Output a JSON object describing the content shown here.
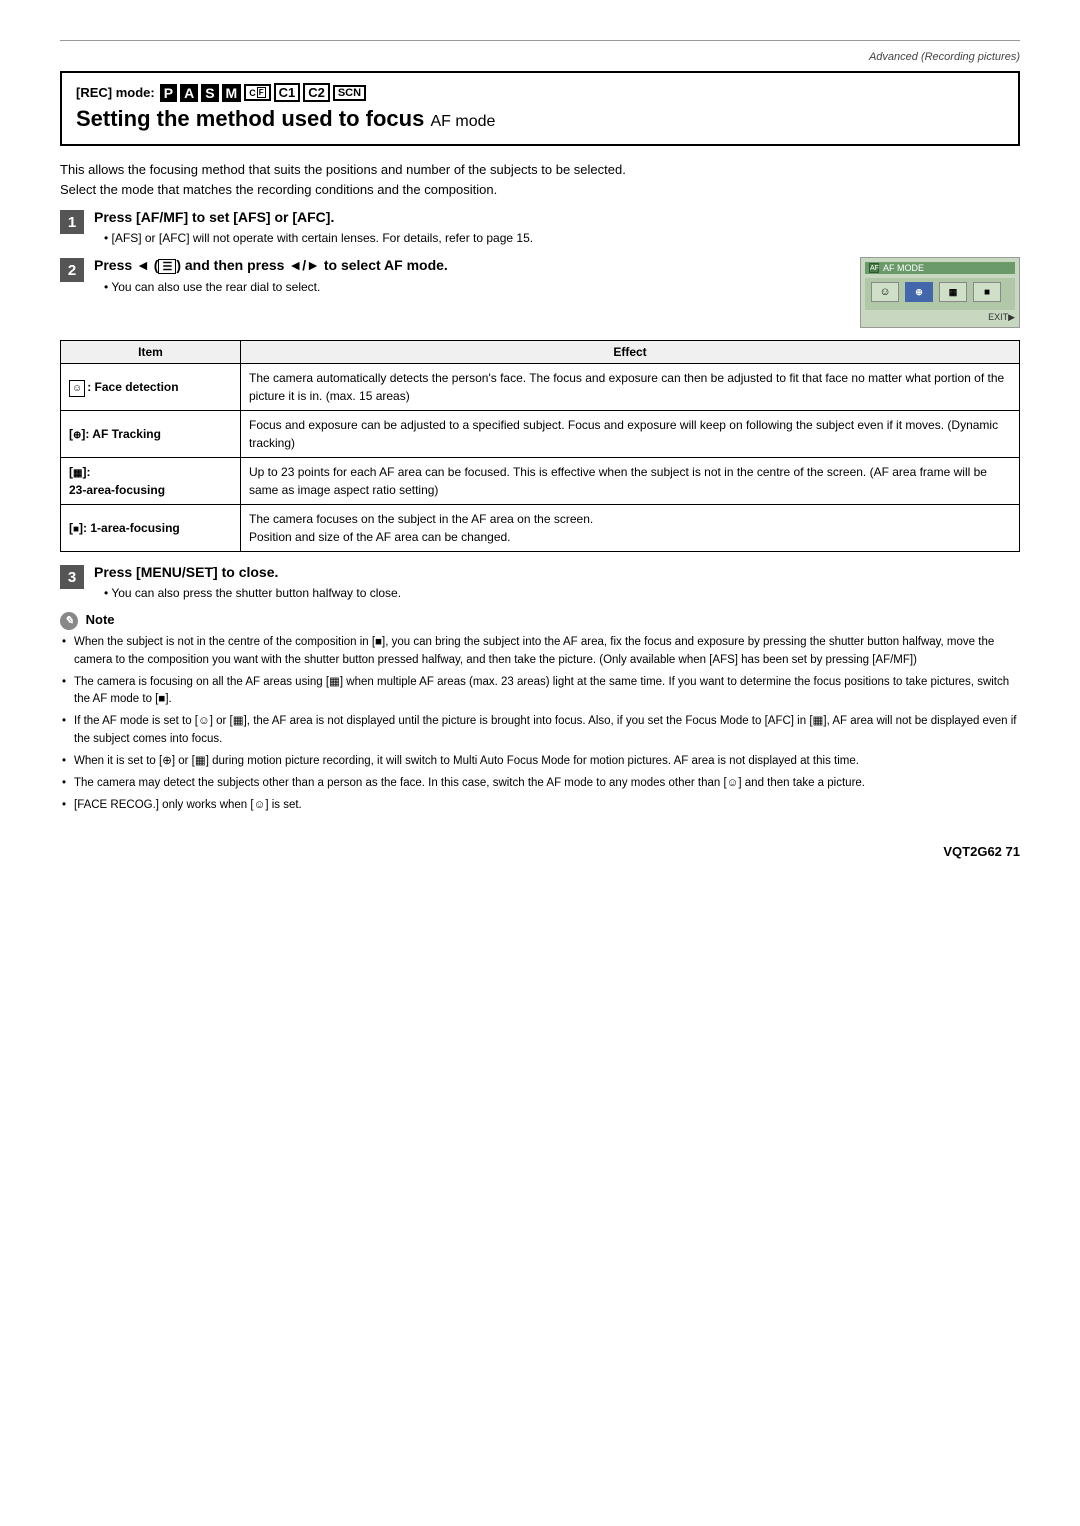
{
  "page": {
    "header": "Advanced (Recording pictures)",
    "footer": "VQT2G62  71"
  },
  "rec_mode": {
    "label": "[REC] mode:",
    "badges": [
      "P",
      "A",
      "S",
      "M",
      "C1",
      "C2",
      "SCN"
    ]
  },
  "section_title": "Setting the method used to focus",
  "section_subtitle": " AF mode",
  "intro": [
    "This allows the focusing method that suits the positions and number of the subjects to be selected.",
    "Select the mode that matches the recording conditions and the composition."
  ],
  "steps": [
    {
      "number": "1",
      "title": "Press [AF/MF] to set [AFS] or [AFC].",
      "notes": [
        "[AFS] or [AFC] will not operate with certain lenses. For details, refer to page 15."
      ]
    },
    {
      "number": "2",
      "title": "Press ◄ (   ) and then press ◄/► to select AF mode.",
      "notes": [
        "You can also use the rear dial to select."
      ],
      "camera_screen": {
        "title": "AF MODE",
        "icons": [
          "face",
          "tracking",
          "multi",
          "single"
        ],
        "selected_index": 1,
        "exit_label": "EXIT"
      }
    },
    {
      "number": "3",
      "title": "Press [MENU/SET] to close.",
      "notes": [
        "You can also press the shutter button halfway to close."
      ]
    }
  ],
  "table": {
    "headers": [
      "Item",
      "Effect"
    ],
    "rows": [
      {
        "item": "[ ]: Face detection",
        "item_icon": "face",
        "effect": "The camera automatically detects the person's face. The focus and exposure can then be adjusted to fit that face no matter what portion of the picture it is in. (max. 15 areas)"
      },
      {
        "item": "[ ]: AF Tracking",
        "item_icon": "tracking",
        "effect": "Focus and exposure can be adjusted to a specified subject. Focus and exposure will keep on following the subject even if it moves. (Dynamic tracking)"
      },
      {
        "item": "[ ]:\n23-area-focusing",
        "item_icon": "multi",
        "effect": "Up to 23 points for each AF area can be focused. This is effective when the subject is not in the centre of the screen. (AF area frame will be same as image aspect ratio setting)"
      },
      {
        "item": "[ ]: 1-area-focusing",
        "item_icon": "single",
        "effect": "The camera focuses on the subject in the AF area on the screen.\nPosition and size of the AF area can be changed."
      }
    ]
  },
  "note": {
    "label": "Note",
    "items": [
      "When the subject is not in the centre of the composition in [■], you can bring the subject into the AF area, fix the focus and exposure by pressing the shutter button halfway, move the camera to the composition you want with the shutter button pressed halfway, and then take the picture. (Only available when [AFS] has been set by pressing [AF/MF])",
      "The camera is focusing on all the AF areas using [▦] when multiple AF areas (max. 23 areas) light at the same time. If you want to determine the focus positions to take pictures, switch the AF mode to [■].",
      "If the AF mode is set to [☺] or [▦], the AF area is not displayed until the picture is brought into focus. Also, if you set the Focus Mode to [AFC] in [▦], AF area will not be displayed even if the subject comes into focus.",
      "When it is set to [⊕] or [▦] during motion picture recording, it will switch to Multi Auto Focus Mode for motion pictures. AF area is not displayed at this time.",
      "The camera may detect the subjects other than a person as the face. In this case, switch the AF mode to any modes other than [☺] and then take a picture.",
      "[FACE RECOG.] only works when [☺] is set."
    ]
  }
}
